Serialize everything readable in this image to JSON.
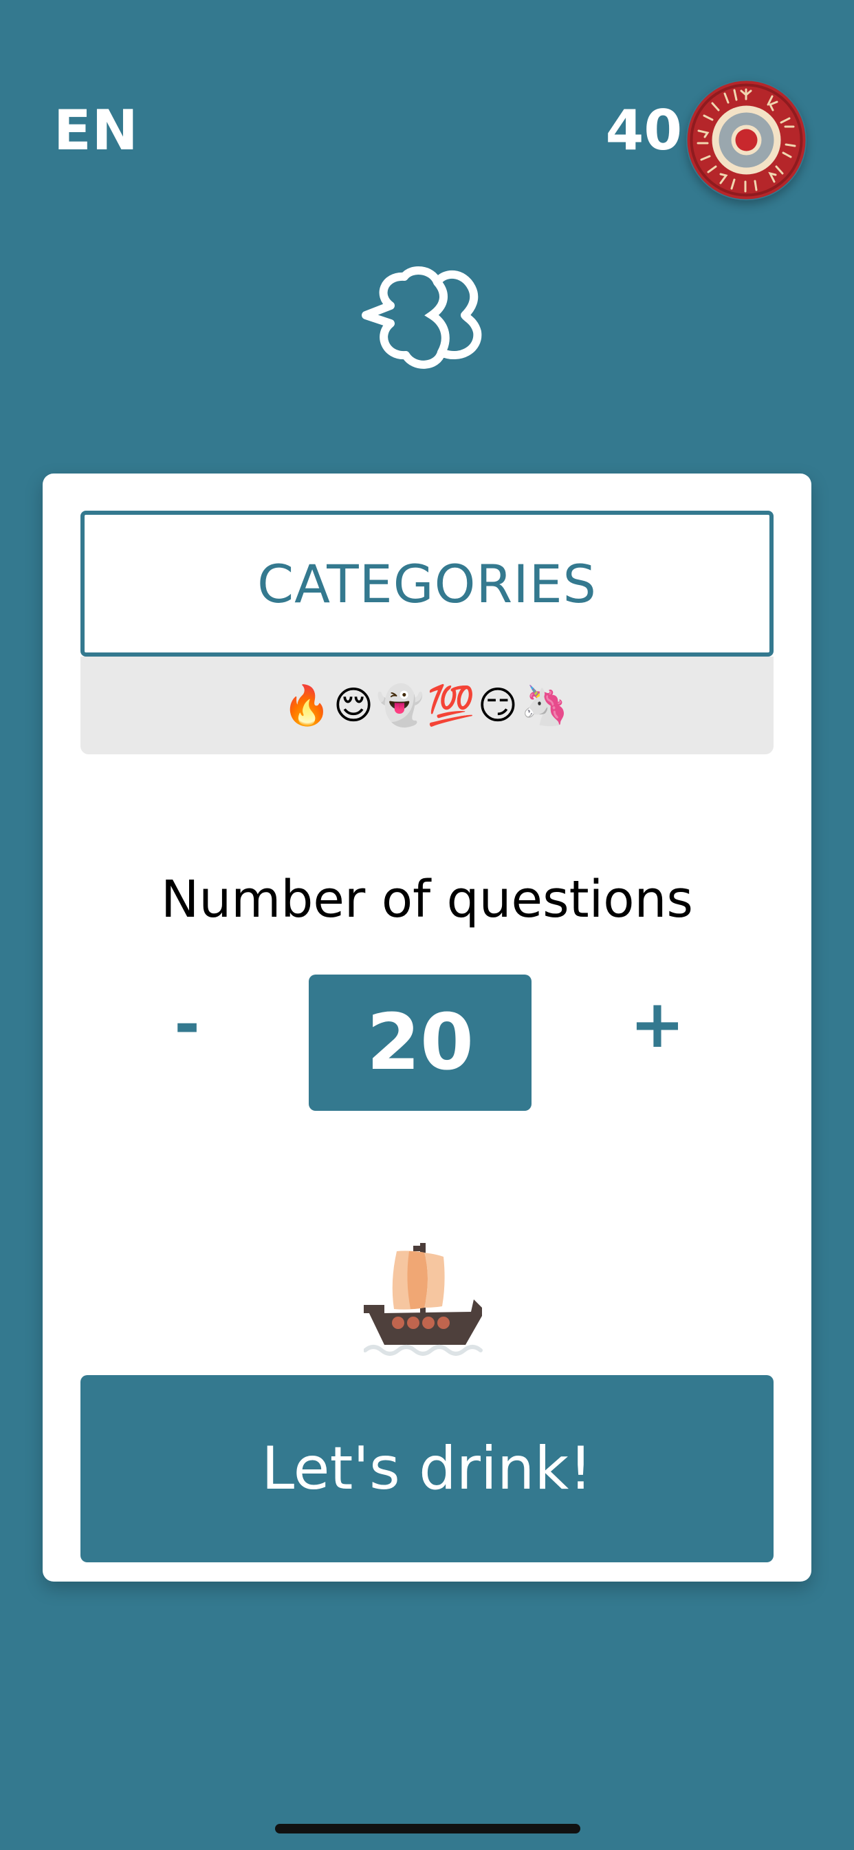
{
  "header": {
    "language": "EN",
    "score": "40",
    "profile_icon": "viking-shield-icon"
  },
  "logo": {
    "icon": "logo-icon"
  },
  "categories": {
    "button_label": "CATEGORIES",
    "selected_emojis": "🔥😌👻💯😏🦄"
  },
  "questions": {
    "label": "Number of questions",
    "decrement_label": "-",
    "increment_label": "+",
    "value": "20"
  },
  "ship": {
    "icon": "viking-ship-icon"
  },
  "start_button": {
    "label": "Let's drink!"
  },
  "colors": {
    "background": "#34798f",
    "card": "#ffffff",
    "accent": "#34798f",
    "strip": "#e9e9e9"
  }
}
